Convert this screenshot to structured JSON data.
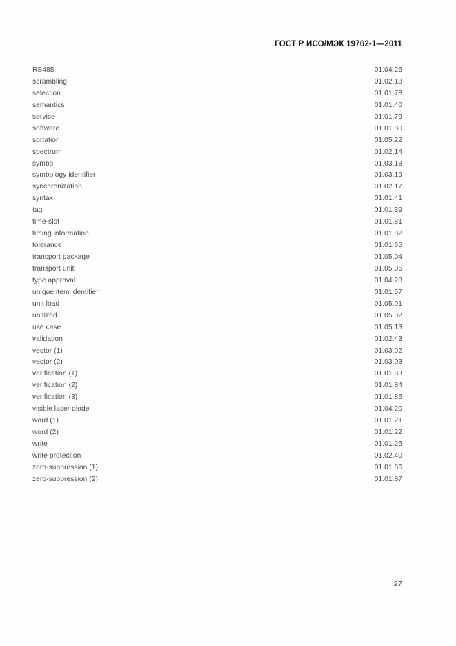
{
  "document": {
    "header_title": "ГОСТ Р ИСО/МЭК 19762-1—2011",
    "page_number": "27"
  },
  "index": {
    "entries": [
      {
        "term": "RS485",
        "code": "01.04.25"
      },
      {
        "term": "scrambling",
        "code": "01.02.18"
      },
      {
        "term": "selection",
        "code": "01.01.78"
      },
      {
        "term": "semantics",
        "code": "01.01.40"
      },
      {
        "term": "service",
        "code": "01.01.79"
      },
      {
        "term": "software",
        "code": "01.01.80"
      },
      {
        "term": "sortation",
        "code": "01.05.22"
      },
      {
        "term": "spectrum",
        "code": "01.02.14"
      },
      {
        "term": "symbol",
        "code": "01.03.18"
      },
      {
        "term": "symbology identifier",
        "code": "01.03.19"
      },
      {
        "term": "synchronization",
        "code": "01.02.17"
      },
      {
        "term": "syntax",
        "code": "01.01.41"
      },
      {
        "term": "tag",
        "code": "01.01.39"
      },
      {
        "term": "time-slot",
        "code": "01.01.81"
      },
      {
        "term": "timing information",
        "code": "01.01.82"
      },
      {
        "term": "tolerance",
        "code": "01.01.65"
      },
      {
        "term": "transport package",
        "code": "01.05.04"
      },
      {
        "term": "transport unit",
        "code": "01.05.05"
      },
      {
        "term": "type approval",
        "code": "01.04.28"
      },
      {
        "term": "unique item identifier",
        "code": "01.01.57"
      },
      {
        "term": "unit load",
        "code": "01.05.01"
      },
      {
        "term": "unitized",
        "code": "01.05.02"
      },
      {
        "term": "use case",
        "code": "01.05.13"
      },
      {
        "term": "validation",
        "code": "01.02.43"
      },
      {
        "term": "vector (1)",
        "code": "01.03.02"
      },
      {
        "term": "vector (2)",
        "code": "01.03.03"
      },
      {
        "term": "verification (1)",
        "code": "01.01.83"
      },
      {
        "term": "verification (2)",
        "code": "01.01.84"
      },
      {
        "term": "verification (3)",
        "code": "01.01.85"
      },
      {
        "term": "visible laser diode",
        "code": "01.04.20"
      },
      {
        "term": "word (1)",
        "code": "01.01.21"
      },
      {
        "term": "word (2)",
        "code": "01.01.22"
      },
      {
        "term": "write",
        "code": "01.01.25"
      },
      {
        "term": "write protection",
        "code": "01.02.40"
      },
      {
        "term": "zero-suppression (1)",
        "code": "01.01.86"
      },
      {
        "term": "zero-suppression (2)",
        "code": "01.01.87"
      }
    ]
  }
}
